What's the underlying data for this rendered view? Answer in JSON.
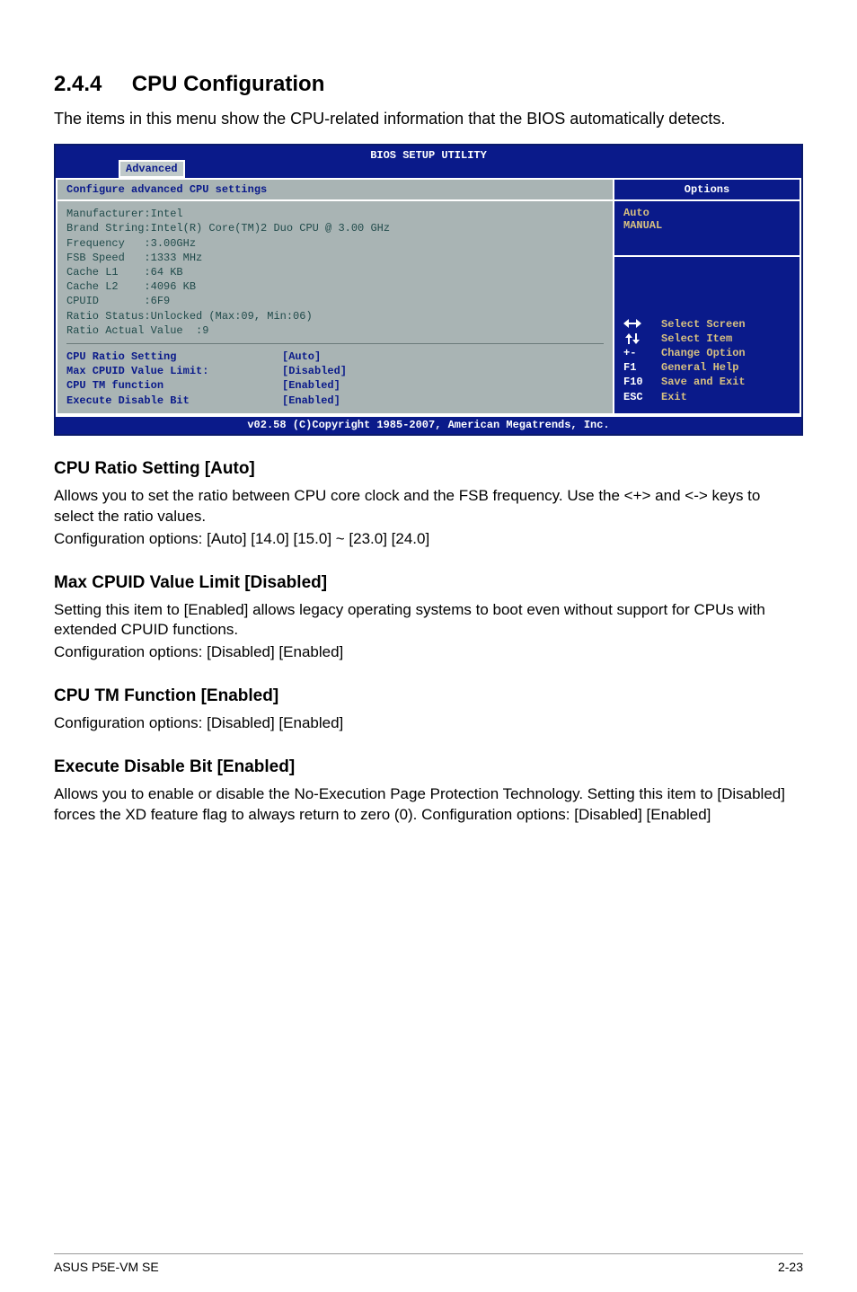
{
  "heading_number": "2.4.4",
  "heading_title": "CPU Configuration",
  "intro_text": "The items in this menu show the CPU-related information that the BIOS automatically detects.",
  "bios": {
    "title": "BIOS SETUP UTILITY",
    "tab": "Advanced",
    "main_header": "Configure advanced CPU settings",
    "info_lines": [
      "Manufacturer:Intel",
      "Brand String:Intel(R) Core(TM)2 Duo CPU @ 3.00 GHz",
      "Frequency   :3.00GHz",
      "FSB Speed   :1333 MHz",
      "Cache L1    :64 KB",
      "Cache L2    :4096 KB",
      "CPUID       :6F9",
      "Ratio Status:Unlocked (Max:09, Min:06)",
      "Ratio Actual Value  :9"
    ],
    "settings": [
      {
        "label": "CPU Ratio Setting",
        "value": "[Auto]"
      },
      {
        "label": "Max CPUID Value Limit:",
        "value": "[Disabled]"
      },
      {
        "label": "CPU TM function",
        "value": "[Enabled]"
      },
      {
        "label": "Execute Disable Bit",
        "value": "[Enabled]"
      }
    ],
    "side": {
      "options_title": "Options",
      "options_list": [
        "Auto",
        "MANUAL"
      ],
      "nav": [
        {
          "key": "←→",
          "label": "Select Screen"
        },
        {
          "key": "↑↓",
          "label": "Select Item"
        },
        {
          "key": "+-",
          "label": "Change Option"
        },
        {
          "key": "F1",
          "label": "General Help"
        },
        {
          "key": "F10",
          "label": "Save and Exit"
        },
        {
          "key": "ESC",
          "label": "Exit"
        }
      ]
    },
    "footer": "v02.58 (C)Copyright 1985-2007, American Megatrends, Inc."
  },
  "sections": [
    {
      "title": "CPU Ratio Setting [Auto]",
      "body": [
        "Allows you to set the ratio between CPU core clock and the FSB frequency. Use the <+> and <-> keys to select the ratio values.",
        "Configuration options: [Auto] [14.0] [15.0] ~ [23.0] [24.0]"
      ]
    },
    {
      "title": "Max CPUID Value Limit [Disabled]",
      "body": [
        "Setting this item to [Enabled] allows legacy operating systems to boot even without support for CPUs with extended CPUID functions.",
        "Configuration options: [Disabled] [Enabled]"
      ]
    },
    {
      "title": "CPU TM Function [Enabled]",
      "body": [
        "Configuration options: [Disabled] [Enabled]"
      ]
    },
    {
      "title": "Execute Disable Bit [Enabled]",
      "body": [
        "Allows you to enable or disable the No-Execution Page Protection Technology. Setting this item to [Disabled] forces the XD feature flag to always return to zero (0). Configuration options: [Disabled] [Enabled]"
      ]
    }
  ],
  "footer_left": "ASUS P5E-VM SE",
  "footer_right": "2-23"
}
